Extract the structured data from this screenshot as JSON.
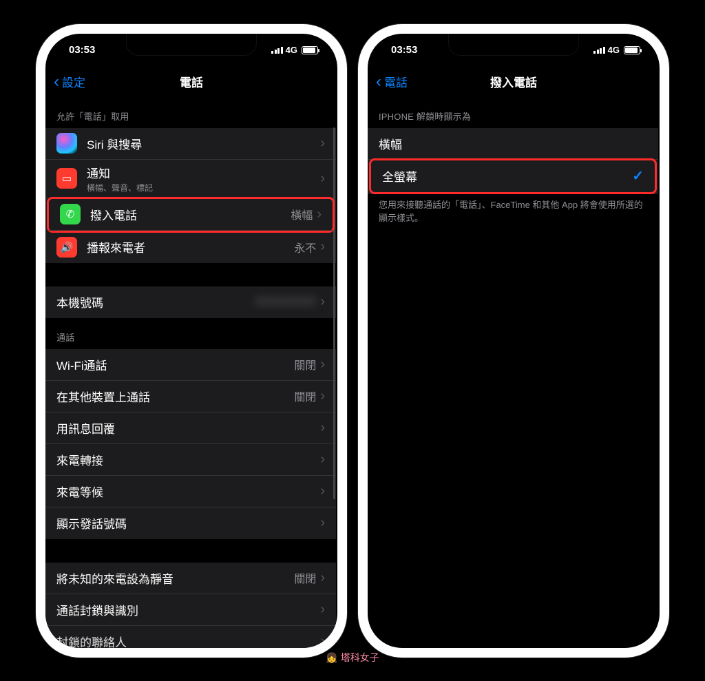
{
  "status": {
    "time": "03:53",
    "network": "4G"
  },
  "left": {
    "back": "設定",
    "title": "電話",
    "section_allow": "允許「電話」取用",
    "rows_allow": {
      "siri": {
        "label": "Siri 與搜尋"
      },
      "notif": {
        "label": "通知",
        "sub": "橫幅、聲音、標記"
      },
      "incoming": {
        "label": "撥入電話",
        "value": "橫幅"
      },
      "announce": {
        "label": "播報來電者",
        "value": "永不"
      }
    },
    "mynumber_label": "本機號碼",
    "section_call": "通話",
    "rows_call": {
      "wifi": {
        "label": "Wi-Fi通話",
        "value": "關閉"
      },
      "other": {
        "label": "在其他裝置上通話",
        "value": "關閉"
      },
      "reply": {
        "label": "用訊息回覆"
      },
      "forward": {
        "label": "來電轉接"
      },
      "waiting": {
        "label": "來電等候"
      },
      "callerid": {
        "label": "顯示發話號碼"
      }
    },
    "rows_bottom": {
      "silence": {
        "label": "將未知的來電設為靜音",
        "value": "關閉"
      },
      "block": {
        "label": "通話封鎖與識別"
      },
      "blocked": {
        "label": "封鎖的聯絡人"
      }
    }
  },
  "right": {
    "back": "電話",
    "title": "撥入電話",
    "section": "IPHONE 解鎖時顯示為",
    "opt_banner": "橫幅",
    "opt_full": "全螢幕",
    "note": "您用來接聽通話的「電話」、FaceTime 和其他 App 將會使用所選的顯示樣式。"
  },
  "watermark": "塔科女子"
}
